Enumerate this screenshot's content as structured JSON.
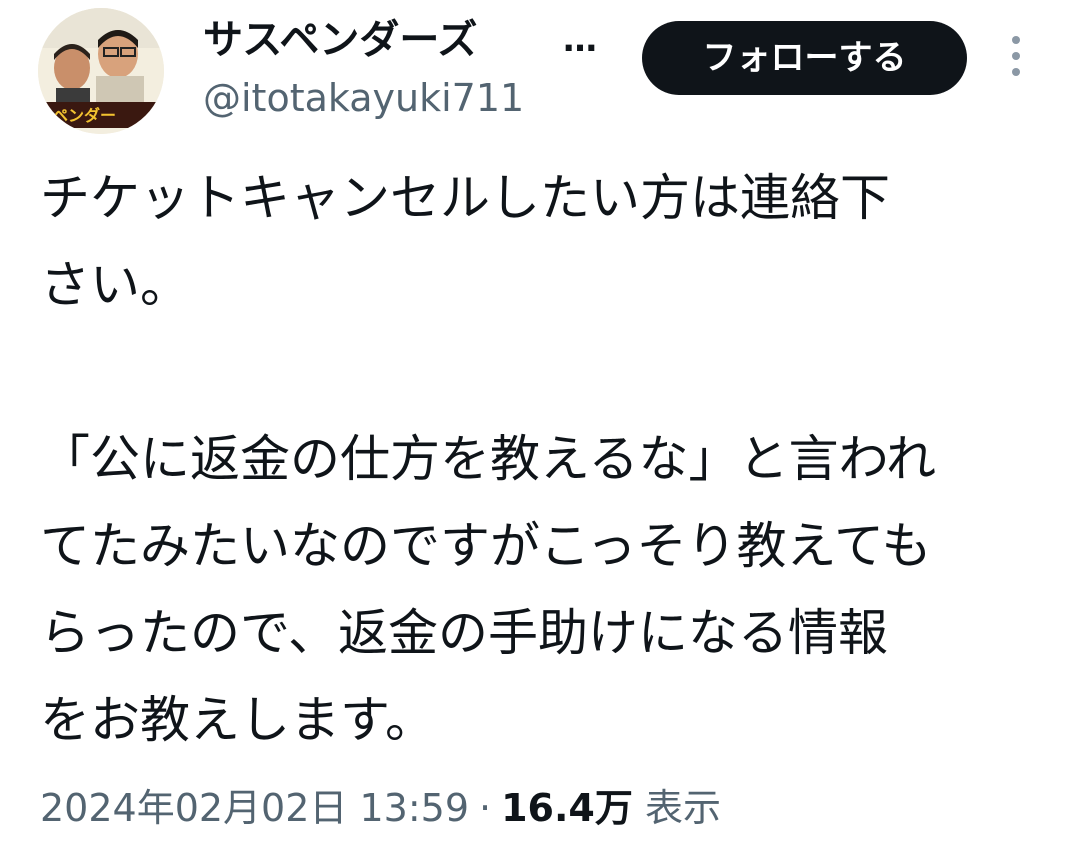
{
  "tweet": {
    "author": {
      "display_name": "サスペンダーズ",
      "handle": "@itotakayuki711",
      "avatar_banner_text": "ペンダー"
    },
    "more_label": "…",
    "follow_label": "フォローする",
    "kebab_icon": "vertical-dots-icon",
    "body": {
      "paragraph1_line1": "チケットキャンセルしたい方は連絡下",
      "paragraph1_line2": "さい。",
      "paragraph2_line1": "「公に返金の仕方を教えるな」と言われ",
      "paragraph2_line2": "てたみたいなのですがこっそり教えても",
      "paragraph2_line3": "らったので、返金の手助けになる情報",
      "paragraph2_line4": "をお教えします。"
    },
    "meta": {
      "timestamp": "2024年02月02日 13:59",
      "separator": "·",
      "views_count": "16.4万",
      "views_label": "表示"
    },
    "colors": {
      "text_primary": "#0f1419",
      "text_secondary": "#536471",
      "follow_bg": "#0f1419",
      "follow_text": "#ffffff"
    }
  }
}
